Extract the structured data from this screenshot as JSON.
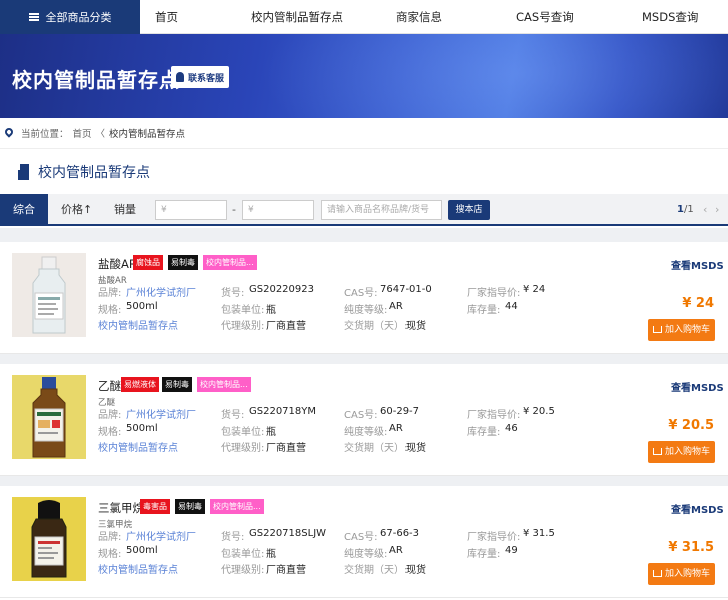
{
  "nav": {
    "all_categories": "全部商品分类",
    "links": [
      "首页",
      "校内管制品暂存点",
      "商家信息",
      "CAS号查询",
      "MSDS查询"
    ]
  },
  "banner": {
    "title": "校内管制品暂存点",
    "contact": "联系客服"
  },
  "breadcrumb": {
    "prefix": "当前位置：",
    "home": "首页",
    "sep": "〈",
    "current": "校内管制品暂存点"
  },
  "section": {
    "title": "校内管制品暂存点"
  },
  "filter": {
    "tabs": [
      "综合",
      "价格↑",
      "销量"
    ],
    "price_min_placeholder": "¥",
    "price_max_placeholder": "¥",
    "dash": "-",
    "search_placeholder": "请输入商品名称品牌/货号",
    "search_button": "搜本店",
    "page_current": "1",
    "page_total": "/1",
    "prev": "‹",
    "next": "›"
  },
  "labels": {
    "brand": "品牌:",
    "code": "货号:",
    "cas": "CAS号:",
    "guide_price": "厂家指导价:",
    "spec": "规格:",
    "pack_unit": "包装单位:",
    "purity": "纯度等级:",
    "stock": "库存量:",
    "agent_level": "代理级别:",
    "delivery": "交货期（天）:",
    "view_msds": "查看MSDS",
    "add_cart": "加入购物车"
  },
  "products": [
    {
      "name": "盐酸AR",
      "sub": "盐酸AR",
      "tags": [
        {
          "text": "腐蚀品",
          "color": "red"
        },
        {
          "text": "易制毒",
          "color": "black"
        },
        {
          "text": "校内管制品...",
          "color": "pink"
        }
      ],
      "brand": "广州化学试剂厂",
      "code": "GS20220923",
      "cas": "7647-01-0",
      "guide_price": "¥ 24",
      "spec": "500ml",
      "pack_unit": "瓶",
      "purity": "AR",
      "stock": "44",
      "store": "校内管制品暂存点",
      "agent_level": "厂商直营",
      "delivery": "现货",
      "price": "¥ 24"
    },
    {
      "name": "乙醚",
      "sub": "乙醚",
      "tags": [
        {
          "text": "易燃液体",
          "color": "red"
        },
        {
          "text": "易制毒",
          "color": "black"
        },
        {
          "text": "校内管制品...",
          "color": "pink"
        }
      ],
      "brand": "广州化学试剂厂",
      "code": "GS220718YM",
      "cas": "60-29-7",
      "guide_price": "¥ 20.5",
      "spec": "500ml",
      "pack_unit": "瓶",
      "purity": "AR",
      "stock": "46",
      "store": "校内管制品暂存点",
      "agent_level": "厂商直营",
      "delivery": "现货",
      "price": "¥ 20.5"
    },
    {
      "name": "三氯甲烷",
      "sub": "三氯甲烷",
      "tags": [
        {
          "text": "毒害品",
          "color": "red"
        },
        {
          "text": "易制毒",
          "color": "black"
        },
        {
          "text": "校内管制品...",
          "color": "pink"
        }
      ],
      "brand": "广州化学试剂厂",
      "code": "GS220718SLJW",
      "cas": "67-66-3",
      "guide_price": "¥ 31.5",
      "spec": "500ml",
      "pack_unit": "瓶",
      "purity": "AR",
      "stock": "49",
      "store": "校内管制品暂存点",
      "agent_level": "厂商直营",
      "delivery": "现货",
      "price": "¥ 31.5"
    }
  ]
}
